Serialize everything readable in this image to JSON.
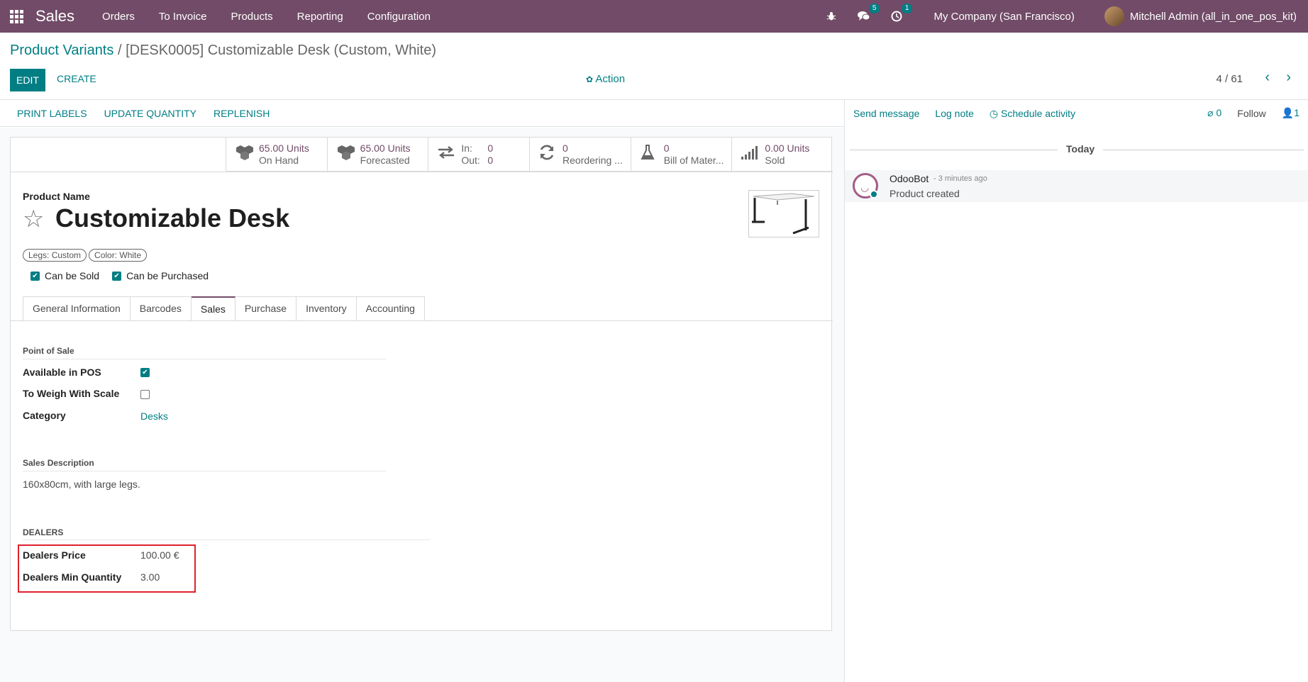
{
  "navbar": {
    "brand": "Sales",
    "menu": [
      "Orders",
      "To Invoice",
      "Products",
      "Reporting",
      "Configuration"
    ],
    "messages_count": "5",
    "activities_count": "1",
    "company": "My Company (San Francisco)",
    "user": "Mitchell Admin (all_in_one_pos_kit)",
    "color": "#714b67"
  },
  "breadcrumb": {
    "parent": "Product Variants",
    "separator": "/",
    "current": "[DESK0005] Customizable Desk (Custom, White)"
  },
  "control": {
    "edit": "EDIT",
    "create": "CREATE",
    "action": "Action",
    "pager": "4 / 61"
  },
  "statusbar": [
    "PRINT LABELS",
    "UPDATE QUANTITY",
    "REPLENISH"
  ],
  "smart_buttons": {
    "on_hand": {
      "value": "65.00 Units",
      "label": "On Hand"
    },
    "forecasted": {
      "value": "65.00 Units",
      "label": "Forecasted"
    },
    "in_out": {
      "in_label": "In:",
      "in_value": "0",
      "out_label": "Out:",
      "out_value": "0"
    },
    "reordering": {
      "value": "0",
      "label": "Reordering ..."
    },
    "bom": {
      "value": "0",
      "label": "Bill of Mater..."
    },
    "sold": {
      "value": "0.00 Units",
      "label": "Sold"
    }
  },
  "product": {
    "name_label": "Product Name",
    "name": "Customizable Desk",
    "tags": [
      "Legs: Custom",
      "Color: White"
    ],
    "can_be_sold": "Can be Sold",
    "can_be_purchased": "Can be Purchased"
  },
  "tabs": [
    "General Information",
    "Barcodes",
    "Sales",
    "Purchase",
    "Inventory",
    "Accounting"
  ],
  "pos": {
    "title": "Point of Sale",
    "available_label": "Available in POS",
    "weigh_label": "To Weigh With Scale",
    "category_label": "Category",
    "category_value": "Desks"
  },
  "sales_desc": {
    "title": "Sales Description",
    "text": "160x80cm, with large legs."
  },
  "dealers": {
    "title": "DEALERS",
    "price_label": "Dealers Price",
    "price_value": "100.00 €",
    "min_qty_label": "Dealers Min Quantity",
    "min_qty_value": "3.00"
  },
  "chatter": {
    "send_message": "Send message",
    "log_note": "Log note",
    "schedule_activity": "Schedule activity",
    "attachments": "0",
    "follow": "Follow",
    "followers": "1",
    "today": "Today",
    "author": "OdooBot",
    "time": "- 3 minutes ago",
    "body": "Product created"
  },
  "colors": {
    "primary": "#017e84",
    "brand": "#714b67",
    "highlight": "#e0202c"
  }
}
